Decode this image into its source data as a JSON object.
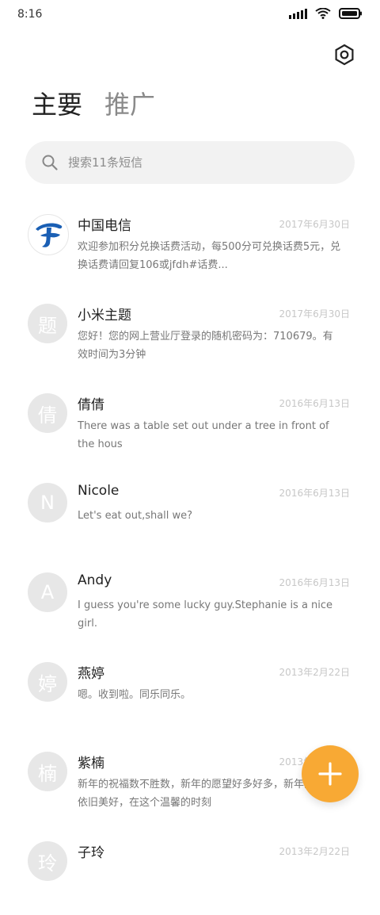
{
  "statusbar": {
    "time": "8:16"
  },
  "tabs": {
    "primary": "主要",
    "secondary": "推广"
  },
  "search": {
    "placeholder": "搜索11条短信"
  },
  "conversations": [
    {
      "name": "中国电信",
      "date": "2017年6月30日",
      "avatar_text": "",
      "avatar_type": "telecom-logo",
      "preview": "欢迎参加积分兑换话费活动，每500分可兑换话费5元，兑换话费请回复106或jfdh#话费..."
    },
    {
      "name": "小米主题",
      "date": "2017年6月30日",
      "avatar_text": "题",
      "preview": "您好！您的网上营业厅登录的随机密码为：710679。有效时间为3分钟"
    },
    {
      "name": "倩倩",
      "date": "2016年6月13日",
      "avatar_text": "倩",
      "preview": "There was a table set out under a tree in front of the hous"
    },
    {
      "name": "Nicole",
      "date": "2016年6月13日",
      "avatar_text": "N",
      "preview": "Let's eat out,shall we?"
    },
    {
      "name": "Andy",
      "date": "2016年6月13日",
      "avatar_text": "A",
      "preview": "I guess you're some lucky guy.Stephanie is a nice girl."
    },
    {
      "name": "燕婷",
      "date": "2013年2月22日",
      "avatar_text": "婷",
      "preview": "嗯。收到啦。同乐同乐。"
    },
    {
      "name": "紫楠",
      "date": "2013年2月22日",
      "avatar_text": "楠",
      "preview": "新年的祝福数不胜数，新年的愿望好多好多，新年的问候依旧美好，在这个温馨的时刻"
    },
    {
      "name": "子玲",
      "date": "2013年2月22日",
      "avatar_text": "玲",
      "preview": ""
    }
  ],
  "colors": {
    "fab": "#f8a934",
    "telecom_blue": "#1a5fb4"
  },
  "icons": {
    "settings": "settings-icon",
    "search": "search-icon",
    "fab": "plus-icon"
  }
}
